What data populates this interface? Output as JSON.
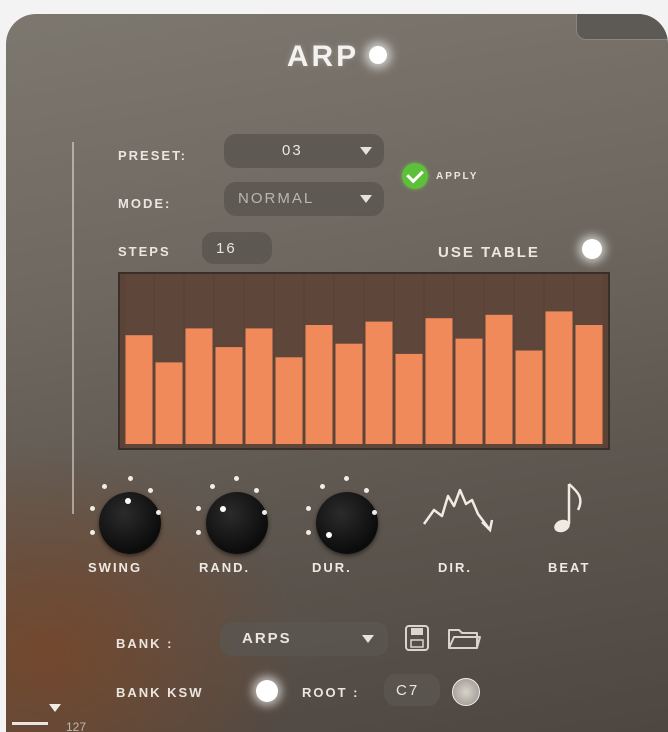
{
  "title": "ARP",
  "preset": {
    "label": "PRESET:",
    "value": "03"
  },
  "mode": {
    "label": "MODE:",
    "value": "NORMAL"
  },
  "apply": {
    "label": "APPLY"
  },
  "steps": {
    "label": "STEPS",
    "value": "16"
  },
  "use_table": {
    "label": "USE TABLE"
  },
  "step_levels": [
    0.64,
    0.48,
    0.68,
    0.57,
    0.68,
    0.51,
    0.7,
    0.59,
    0.72,
    0.53,
    0.74,
    0.62,
    0.76,
    0.55,
    0.78,
    0.7
  ],
  "colors": {
    "step_bar": "#f08a5a",
    "table_bg": "#5b4338",
    "apply_green": "#5cc038"
  },
  "controls": {
    "swing": "SWING",
    "rand": "RAND.",
    "dur": "DUR.",
    "dir": "DIR.",
    "beat": "BEAT"
  },
  "bank": {
    "label": "BANK :",
    "value": "ARPS"
  },
  "bank_ksw": {
    "label": "BANK KSW"
  },
  "root": {
    "label": "ROOT :",
    "value": "C7"
  },
  "bottom_value": "127"
}
